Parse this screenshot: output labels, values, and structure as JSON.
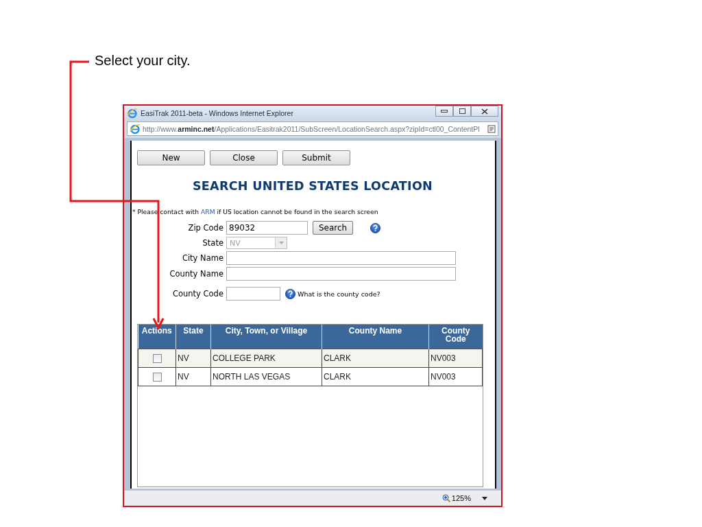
{
  "slide": {
    "callout": "Select your city."
  },
  "window": {
    "title": "EasiTrak 2011-beta - Windows Internet Explorer",
    "address": "http://www.**arminc.net**/Applications/Easitrak2011/SubScreen/LocationSearch.aspx?zipId=ctl00_ContentPl"
  },
  "toolbar": [
    "New",
    "Close",
    "Submit"
  ],
  "heading": "SEARCH UNITED STATES LOCATION",
  "note": {
    "before": "* Please contact with ",
    "link": "ARM",
    "after": " if US location cannot be found in the search screen"
  },
  "form": {
    "zip": {
      "label": "Zip Code",
      "value": "89032",
      "button": "Search"
    },
    "state": {
      "label": "State",
      "value": "NV",
      "disabled": true
    },
    "city": {
      "label": "City Name"
    },
    "county": {
      "label": "County Name"
    },
    "county_code": {
      "label": "County Code",
      "help": "What is the county code?"
    }
  },
  "table": {
    "columns": [
      "Actions",
      "State",
      "City, Town, or Village",
      "County Name",
      "County Code"
    ],
    "rows": [
      {
        "checked": false,
        "state": "NV",
        "city": "COLLEGE PARK",
        "county": "CLARK",
        "code": "NV003"
      },
      {
        "checked": false,
        "state": "NV",
        "city": "NORTH LAS VEGAS",
        "county": "CLARK",
        "code": "NV003"
      }
    ]
  },
  "status_bar": {
    "zoom": "125%"
  }
}
